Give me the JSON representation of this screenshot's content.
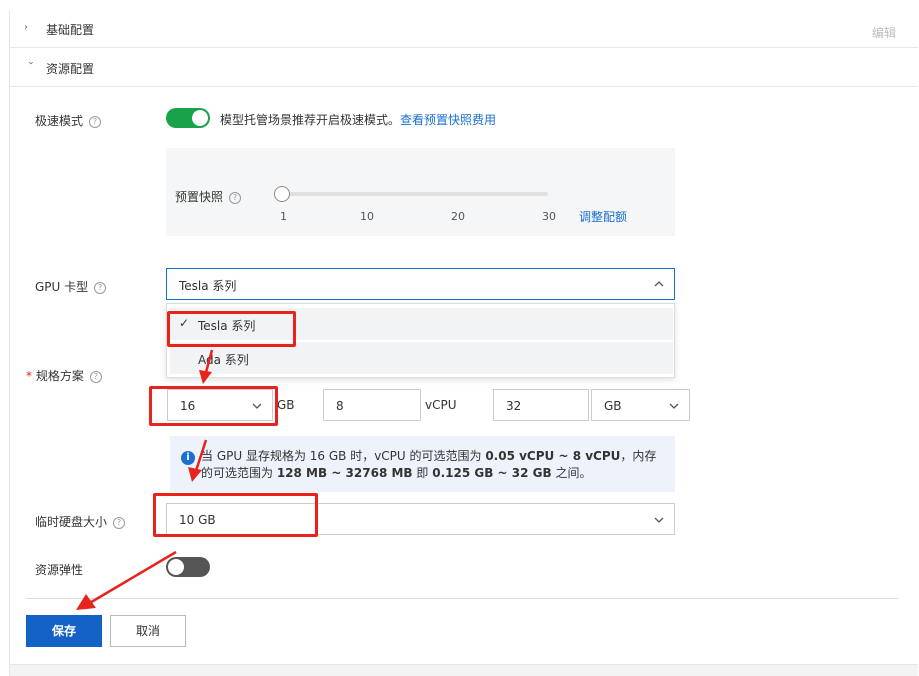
{
  "sections": {
    "basic": {
      "title": "基础配置",
      "edit": "编辑"
    },
    "resource": {
      "title": "资源配置"
    }
  },
  "speed_mode": {
    "label": "极速模式",
    "enabled": true,
    "description": "模型托管场景推荐开启极速模式。",
    "link": "查看预置快照费用"
  },
  "snapshot": {
    "label": "预置快照",
    "value": 1,
    "ticks": [
      "1",
      "10",
      "20",
      "30"
    ],
    "adjust_link": "调整配额"
  },
  "gpu_type": {
    "label": "GPU 卡型",
    "selected": "Tesla 系列",
    "options": [
      {
        "label": "Tesla 系列",
        "selected": true
      },
      {
        "label": "Ada 系列",
        "selected": false
      }
    ]
  },
  "spec": {
    "label": "规格方案",
    "required_mark": "*",
    "gpu_mem": {
      "value": "16",
      "unit": "GB"
    },
    "vcpu": {
      "value": "8",
      "unit": "vCPU"
    },
    "memory": {
      "value": "32",
      "unit": "GB"
    }
  },
  "info": {
    "icon": "info-icon",
    "part1": "当 GPU 显存规格为 16 GB 时，vCPU 的可选范围为 ",
    "bold1": "0.05 vCPU ~ 8 vCPU",
    "part2": "，内存的可选范围为 ",
    "bold2": "128 MB ~ 32768 MB",
    "part3": " 即 ",
    "bold3": "0.125 GB ~ 32 GB",
    "part4": " 之间。"
  },
  "temp_disk": {
    "label": "临时硬盘大小",
    "value": "10 GB"
  },
  "elasticity": {
    "label": "资源弹性",
    "enabled": false
  },
  "buttons": {
    "save": "保存",
    "cancel": "取消"
  },
  "colors": {
    "accent": "#1462c7",
    "toggle_on": "#18a34a",
    "annotation": "#e8231b"
  }
}
